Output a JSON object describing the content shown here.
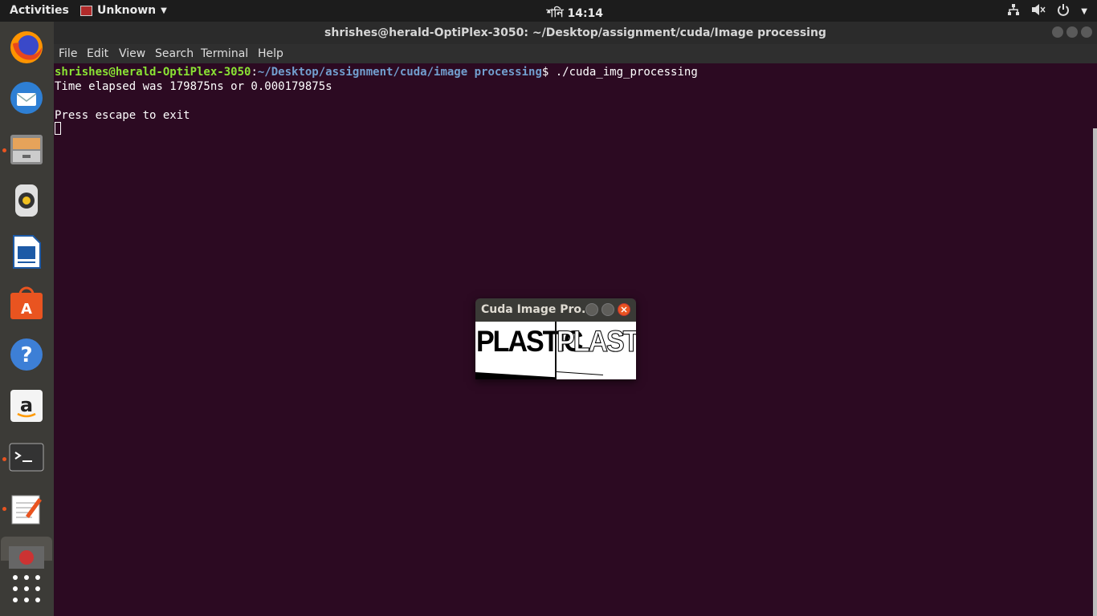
{
  "topbar": {
    "activities": "Activities",
    "app_menu": "Unknown",
    "clock": "শনি 14:14",
    "icons": [
      "network-icon",
      "volume-muted-icon",
      "power-icon",
      "chevron-down-icon"
    ]
  },
  "dock": {
    "items": [
      {
        "name": "firefox",
        "running": false
      },
      {
        "name": "thunderbird",
        "running": false
      },
      {
        "name": "files",
        "running": true
      },
      {
        "name": "rhythmbox",
        "running": false
      },
      {
        "name": "libreoffice-writer",
        "running": false
      },
      {
        "name": "ubuntu-software",
        "running": false
      },
      {
        "name": "help",
        "running": false
      },
      {
        "name": "amazon",
        "running": false
      },
      {
        "name": "terminal",
        "running": true
      },
      {
        "name": "text-editor",
        "running": true
      },
      {
        "name": "image-viewer",
        "running": false
      }
    ],
    "show_apps": "show-applications"
  },
  "terminal": {
    "title": "shrishes@herald-OptiPlex-3050: ~/Desktop/assignment/cuda/Image processing",
    "menu": [
      "File",
      "Edit",
      "View",
      "Search",
      "Terminal",
      "Help"
    ],
    "prompt_user": "shrishes@herald-OptiPlex-3050",
    "prompt_sep": ":",
    "prompt_path": "~/Desktop/assignment/cuda/image processing",
    "prompt_command": "$ ./cuda_img_processing",
    "output": [
      "Time elapsed was 179875ns or 0.000179875s",
      "",
      "Press escape to exit"
    ]
  },
  "cuda_window": {
    "title": "Cuda Image Pro...",
    "image_left_text": "PLASTIC",
    "image_right_text": "PLASTIC"
  },
  "colors": {
    "terminal_bg": "#2c0a22",
    "prompt_user": "#8ae234",
    "prompt_path": "#729fcf",
    "close_button": "#e95420",
    "dock_bg": "#3c3b37"
  }
}
